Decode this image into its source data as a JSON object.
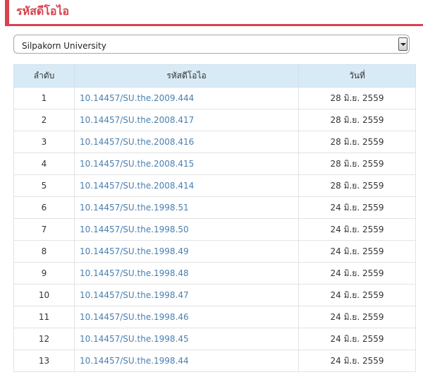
{
  "header": {
    "title": "รหัสดีโอไอ"
  },
  "institution_select": {
    "selected": "Silpakorn University"
  },
  "table": {
    "columns": {
      "order": "ลำดับ",
      "doi": "รหัสดีโอไอ",
      "date": "วันที่"
    },
    "rows": [
      {
        "order": "1",
        "doi": "10.14457/SU.the.2009.444",
        "date": "28 มิ.ย. 2559"
      },
      {
        "order": "2",
        "doi": "10.14457/SU.the.2008.417",
        "date": "28 มิ.ย. 2559"
      },
      {
        "order": "3",
        "doi": "10.14457/SU.the.2008.416",
        "date": "28 มิ.ย. 2559"
      },
      {
        "order": "4",
        "doi": "10.14457/SU.the.2008.415",
        "date": "28 มิ.ย. 2559"
      },
      {
        "order": "5",
        "doi": "10.14457/SU.the.2008.414",
        "date": "28 มิ.ย. 2559"
      },
      {
        "order": "6",
        "doi": "10.14457/SU.the.1998.51",
        "date": "24 มิ.ย. 2559"
      },
      {
        "order": "7",
        "doi": "10.14457/SU.the.1998.50",
        "date": "24 มิ.ย. 2559"
      },
      {
        "order": "8",
        "doi": "10.14457/SU.the.1998.49",
        "date": "24 มิ.ย. 2559"
      },
      {
        "order": "9",
        "doi": "10.14457/SU.the.1998.48",
        "date": "24 มิ.ย. 2559"
      },
      {
        "order": "10",
        "doi": "10.14457/SU.the.1998.47",
        "date": "24 มิ.ย. 2559"
      },
      {
        "order": "11",
        "doi": "10.14457/SU.the.1998.46",
        "date": "24 มิ.ย. 2559"
      },
      {
        "order": "12",
        "doi": "10.14457/SU.the.1998.45",
        "date": "24 มิ.ย. 2559"
      },
      {
        "order": "13",
        "doi": "10.14457/SU.the.1998.44",
        "date": "24 มิ.ย. 2559"
      }
    ]
  },
  "colors": {
    "accent": "#d9414f",
    "header_bg": "#d8eaf5",
    "link": "#4a7fb0"
  }
}
